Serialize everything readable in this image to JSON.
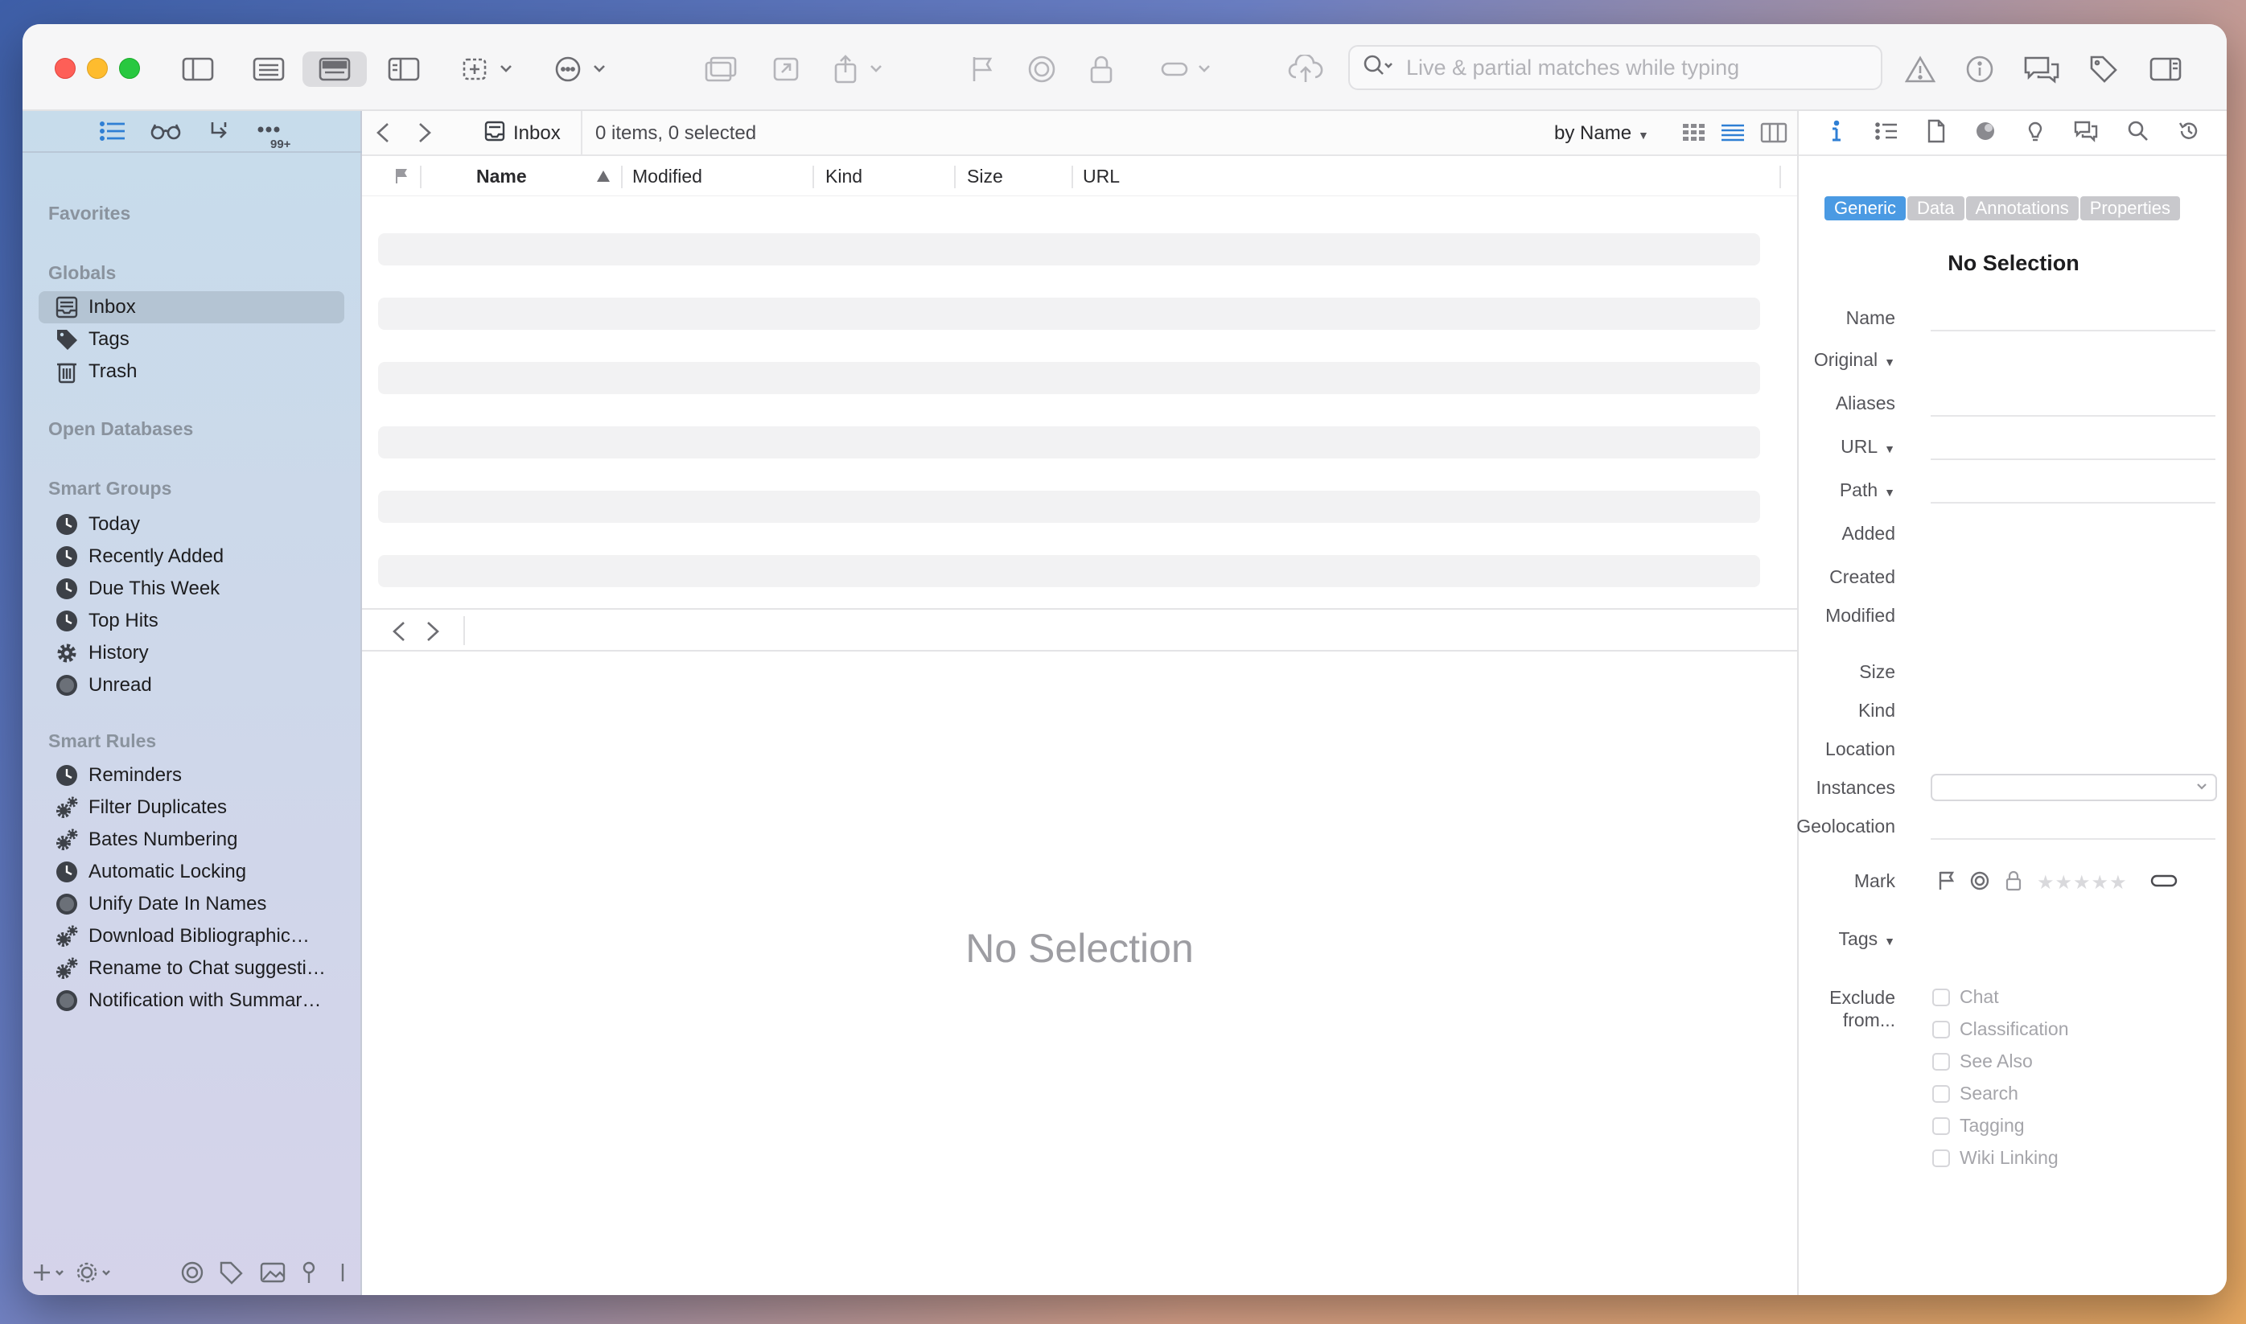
{
  "toolbar": {
    "search_placeholder": "Live & partial matches while typing"
  },
  "sidebar": {
    "sections": {
      "favorites": "Favorites",
      "globals": "Globals",
      "open_databases": "Open Databases",
      "smart_groups": "Smart Groups",
      "smart_rules": "Smart Rules"
    },
    "tab_badge": "99+",
    "globals": [
      {
        "label": "Inbox",
        "icon": "inbox-icon"
      },
      {
        "label": "Tags",
        "icon": "tag-icon"
      },
      {
        "label": "Trash",
        "icon": "trash-icon"
      }
    ],
    "smart_groups": [
      {
        "label": "Today",
        "icon": "clock-icon"
      },
      {
        "label": "Recently Added",
        "icon": "clock-icon"
      },
      {
        "label": "Due This Week",
        "icon": "clock-icon"
      },
      {
        "label": "Top Hits",
        "icon": "clock-icon"
      },
      {
        "label": "History",
        "icon": "gear-icon"
      },
      {
        "label": "Unread",
        "icon": "circle-icon"
      }
    ],
    "smart_rules": [
      {
        "label": "Reminders",
        "icon": "clock-icon"
      },
      {
        "label": "Filter Duplicates",
        "icon": "gears-icon"
      },
      {
        "label": "Bates Numbering",
        "icon": "gears-icon"
      },
      {
        "label": "Automatic Locking",
        "icon": "clock-icon"
      },
      {
        "label": "Unify Date In Names",
        "icon": "circle-icon"
      },
      {
        "label": "Download Bibliographic…",
        "icon": "gears-icon"
      },
      {
        "label": "Rename to Chat suggesti…",
        "icon": "gears-icon"
      },
      {
        "label": "Notification with Summar…",
        "icon": "circle-icon"
      }
    ]
  },
  "pathbar": {
    "location": "Inbox",
    "count": "0 items, 0 selected",
    "sort": "by Name"
  },
  "columns": {
    "name": "Name",
    "modified": "Modified",
    "kind": "Kind",
    "size": "Size",
    "url": "URL"
  },
  "main": {
    "no_selection": "No Selection"
  },
  "inspector": {
    "segments": [
      "Generic",
      "Data",
      "Annotations",
      "Properties"
    ],
    "active_segment": "Generic",
    "title": "No Selection",
    "labels": {
      "name": "Name",
      "original": "Original",
      "aliases": "Aliases",
      "url": "URL",
      "path": "Path",
      "added": "Added",
      "created": "Created",
      "modified": "Modified",
      "size": "Size",
      "kind": "Kind",
      "location": "Location",
      "instances": "Instances",
      "geolocation": "Geolocation",
      "mark": "Mark",
      "tags": "Tags",
      "exclude_line1": "Exclude",
      "exclude_line2": "from..."
    },
    "exclude_options": [
      "Chat",
      "Classification",
      "See Also",
      "Search",
      "Tagging",
      "Wiki Linking"
    ],
    "rating_stars": "★★★★★"
  },
  "colors": {
    "accent": "#4a9ae3",
    "sidebar_selected": "#b4c4d3"
  }
}
